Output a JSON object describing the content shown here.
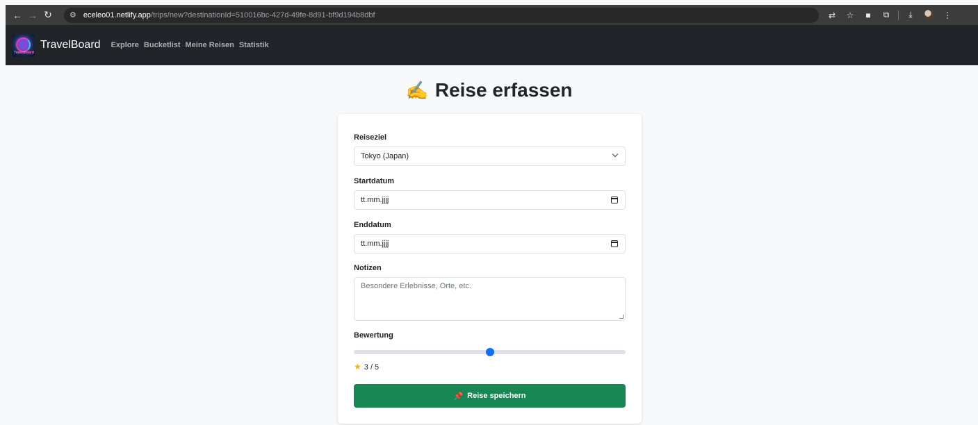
{
  "browser": {
    "url_host": "eceleo01.netlify.app",
    "url_path": "/trips/new?destinationId=510016bc-427d-49fe-8d91-bf9d194b8dbf"
  },
  "navbar": {
    "brand": "TravelBoard",
    "logo_text": "TravelBoard",
    "links": [
      "Explore",
      "Bucketlist",
      "Meine Reisen",
      "Statistik"
    ]
  },
  "page": {
    "title": "Reise erfassen",
    "title_icon": "✍️"
  },
  "form": {
    "destination_label": "Reiseziel",
    "destination_value": "Tokyo (Japan)",
    "start_label": "Startdatum",
    "start_placeholder": "tt.mm.jjjj",
    "end_label": "Enddatum",
    "end_placeholder": "tt.mm.jjjj",
    "notes_label": "Notizen",
    "notes_placeholder": "Besondere Erlebnisse, Orte, etc.",
    "rating_label": "Bewertung",
    "rating_value": 3,
    "rating_max": 5,
    "rating_text": "3 / 5",
    "save_label": "Reise speichern"
  },
  "colors": {
    "navbar_bg": "#212529",
    "save_button": "#198754",
    "slider_thumb": "#0d6efd"
  }
}
